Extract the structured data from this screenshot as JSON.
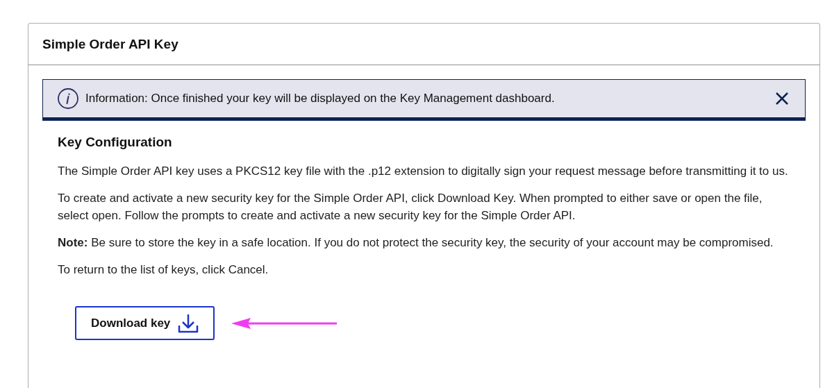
{
  "panel": {
    "title": "Simple Order API Key"
  },
  "alert": {
    "text": "Information: Once finished your key will be displayed on the Key Management dashboard."
  },
  "section": {
    "heading": "Key Configuration",
    "paragraphs": [
      "The Simple Order API key uses a PKCS12 key file with the .p12 extension to digitally sign your request message before transmitting it to us.",
      "To create and activate a new security key for the Simple Order API, click Download Key. When prompted to either save or open the file, select open. Follow the prompts to create and activate a new security key for the Simple Order API.",
      "**Note:** Be sure to store the key in a safe location. If you do not protect the security key, the security of your account may be compromised.",
      "To return to the list of keys, click Cancel."
    ]
  },
  "download_button": {
    "label": "Download key"
  }
}
